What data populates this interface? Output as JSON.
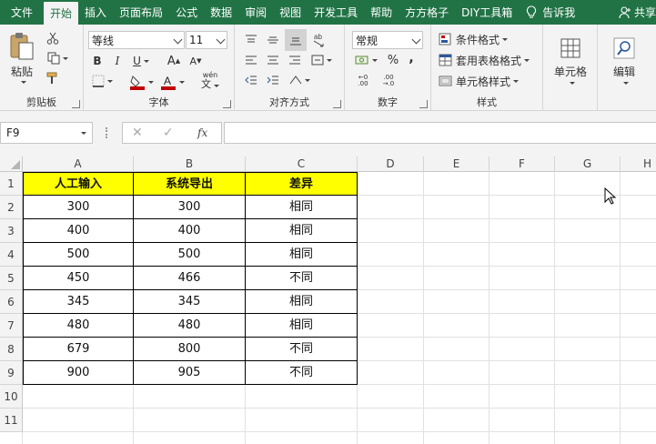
{
  "tabs": [
    "文件",
    "开始",
    "插入",
    "页面布局",
    "公式",
    "数据",
    "审阅",
    "视图",
    "开发工具",
    "帮助",
    "方方格子",
    "DIY工具箱"
  ],
  "tell_me": "告诉我",
  "share": "共享",
  "ribbon": {
    "clipboard": {
      "paste": "粘贴",
      "label": "剪贴板"
    },
    "font": {
      "name": "等线",
      "size": "11",
      "bold": "B",
      "italic": "I",
      "underline": "U",
      "grow": "A",
      "shrink": "A",
      "wen": "wén",
      "label": "字体"
    },
    "align": {
      "label": "对齐方式"
    },
    "number": {
      "format": "常规",
      "percent": "%",
      "comma": ",",
      "label": "数字"
    },
    "styles": {
      "conditional": "条件格式",
      "table": "套用表格格式",
      "cell_style": "单元格样式",
      "label": "样式"
    },
    "cells": {
      "label": "单元格"
    },
    "editing": {
      "label": "编辑"
    }
  },
  "formula_bar": {
    "name_box": "F9",
    "fx": "fx",
    "value": ""
  },
  "columns": [
    "A",
    "B",
    "C",
    "D",
    "E",
    "F",
    "G",
    "H"
  ],
  "rows": [
    "1",
    "2",
    "3",
    "4",
    "5",
    "6",
    "7",
    "8",
    "9",
    "10",
    "11"
  ],
  "table": {
    "headers": [
      "人工输入",
      "系统导出",
      "差异"
    ],
    "data": [
      [
        "300",
        "300",
        "相同"
      ],
      [
        "400",
        "400",
        "相同"
      ],
      [
        "500",
        "500",
        "相同"
      ],
      [
        "450",
        "466",
        "不同"
      ],
      [
        "345",
        "345",
        "相同"
      ],
      [
        "480",
        "480",
        "相同"
      ],
      [
        "679",
        "800",
        "不同"
      ],
      [
        "900",
        "905",
        "不同"
      ]
    ]
  },
  "colors": {
    "accent": "#217346",
    "header_fill": "#ffff00",
    "font_red": "#c00000"
  }
}
